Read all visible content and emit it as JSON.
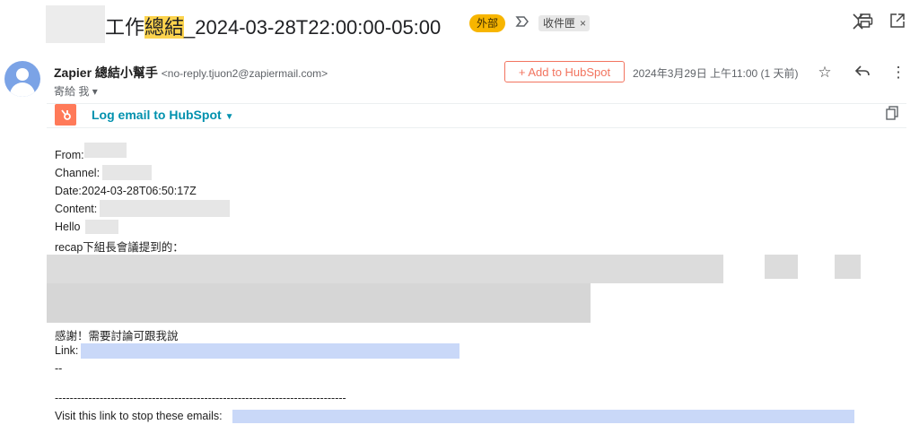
{
  "subject": {
    "prefix": "工作",
    "highlight": "總結",
    "rest": "_2024-03-28T22:00:00-05:00"
  },
  "tags": {
    "external": "外部",
    "label": "收件匣",
    "label_remove": "×"
  },
  "icons": {
    "important": "important-icon",
    "collapse": "collapse-icon",
    "print": "print-icon",
    "open_new": "open-new-window-icon",
    "star": "star-icon",
    "reply": "reply-icon",
    "more": "more-vert-icon",
    "copy": "copy-icon",
    "hubspot_logo": "hubspot-logo-icon"
  },
  "sender": {
    "name": "Zapier 總結小幫手",
    "email": "<no-reply.tjuon2@zapiermail.com>",
    "to": "寄給 我"
  },
  "hubspot": {
    "add_button": "+ Add to HubSpot",
    "log_label": "Log email to HubSpot"
  },
  "datetime": "2024年3月29日 上午11:00 (1 天前)",
  "body": {
    "from_label": "From:",
    "channel_label": "Channel:",
    "date": "Date:2024-03-28T06:50:17Z",
    "content_label": "Content:",
    "hello": "Hello",
    "recap": "recap下組長會議提到的：",
    "thanks": "感謝！需要討論可跟我說",
    "link_label": "Link:",
    "dashes": "--",
    "separator": "------------------------------------------------------------------------------",
    "stop_emails": "Visit this link to stop these emails:"
  },
  "colors": {
    "accent_hubspot": "#ff7a59",
    "link_blue": "#0091ae",
    "external_tag": "#f7b500"
  }
}
